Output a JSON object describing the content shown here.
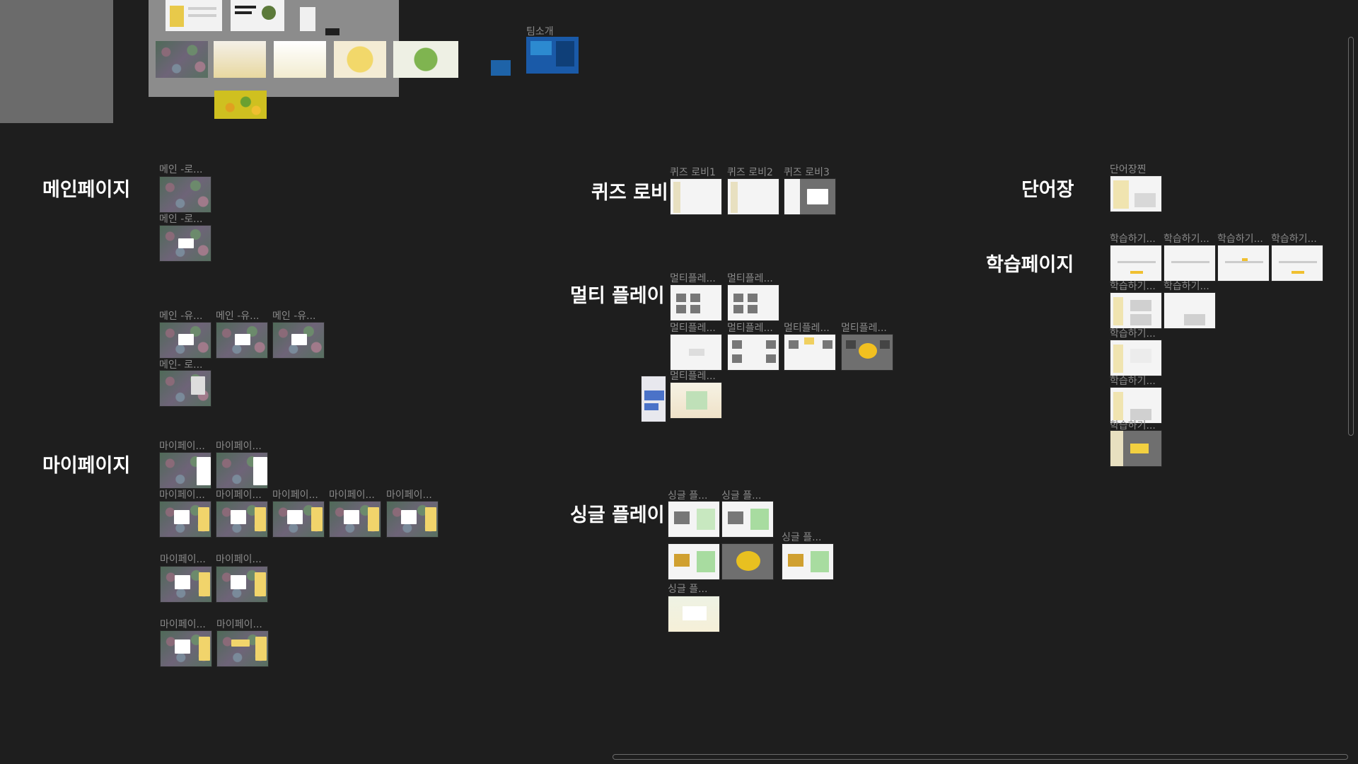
{
  "top_label": "팀소개",
  "sections": {
    "main": "메인페이지",
    "mypage": "마이페이지",
    "quiz_lobby": "퀴즈 로비",
    "multi": "멀티 플레이",
    "single": "싱글 플레이",
    "vocab": "단어장",
    "study": "학습페이지"
  },
  "frames": {
    "main_1": "메인 -로...",
    "main_2": "메인 -로...",
    "main_u1": "메인 -유...",
    "main_u2": "메인 -유...",
    "main_u3": "메인 -유...",
    "main_r": "메인- 로...",
    "my_1": "마이페이...",
    "my_2": "마이페이...",
    "my_3": "마이페이...",
    "my_4": "마이페이...",
    "my_5": "마이페이...",
    "my_6": "마이페이...",
    "my_7": "마이페이...",
    "my_8": "마이페이...",
    "my_9": "마이페이...",
    "my_10": "마이페이...",
    "my_11": "마이페이...",
    "quiz_1": "퀴즈 로비1",
    "quiz_2": "퀴즈 로비2",
    "quiz_3": "퀴즈 로비3",
    "multi_1": "멀티플레...",
    "multi_2": "멀티플레...",
    "multi_3": "멀티플레...",
    "multi_4": "멀티플레...",
    "multi_5": "멀티플레...",
    "multi_6": "멀티플레...",
    "multi_7": "멀티플레...",
    "single_1": "싱글 플...",
    "single_2": "싱글 플...",
    "single_3": "싱글 플...",
    "single_4": "싱글 플...",
    "vocab_1": "단어장찐",
    "study_1": "학습하기...",
    "study_2": "학습하기...",
    "study_3": "학습하기...",
    "study_4": "학습하기...",
    "study_5": "학습하기...",
    "study_6": "학습하기...",
    "study_7": "학습하기...",
    "study_8": "학습하기...",
    "study_9": "학습하기..."
  },
  "colors": {
    "canvas": "#1e1e1e",
    "section_text": "#ffffff",
    "frame_label": "#8a8a8a"
  }
}
